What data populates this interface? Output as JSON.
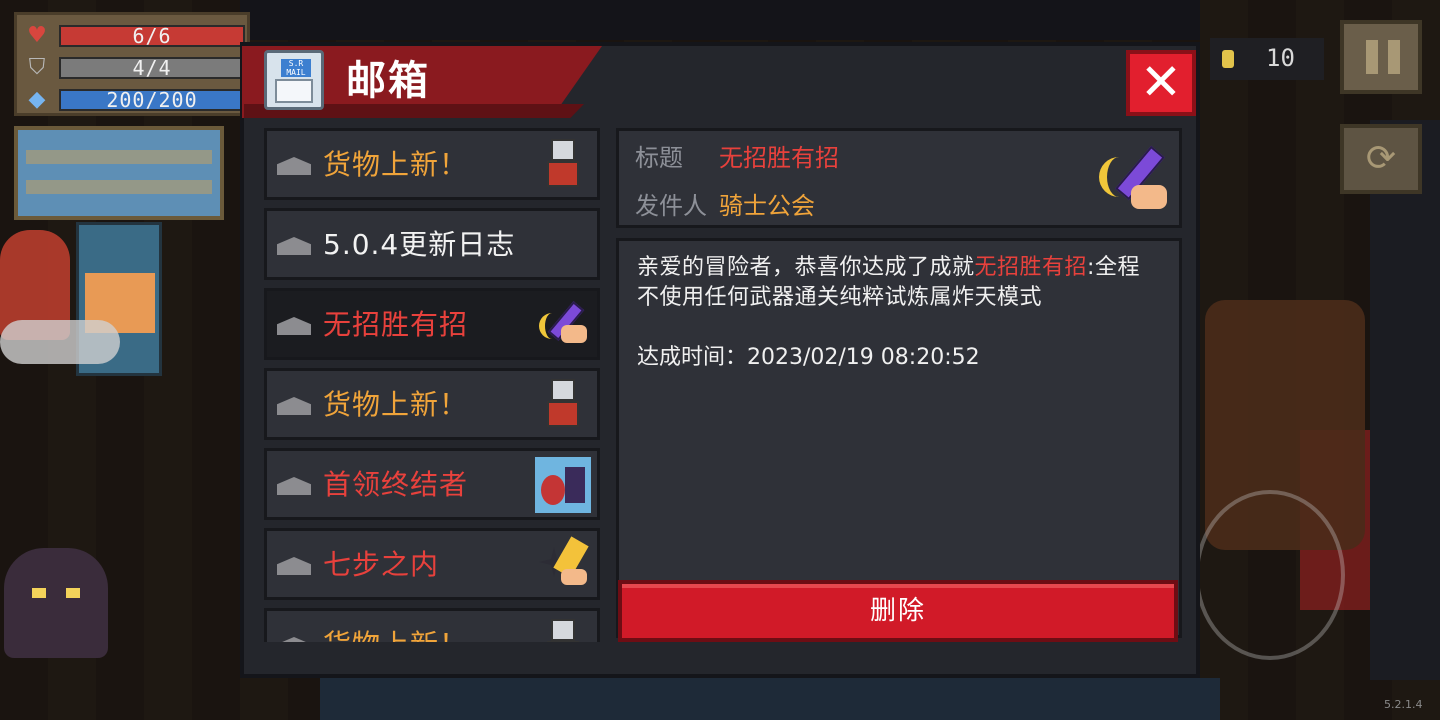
{
  "hud": {
    "hp": "6/6",
    "armor": "4/4",
    "energy": "200/200",
    "hp_icon": "heart-icon",
    "armor_icon": "shield-icon",
    "energy_icon": "gem-icon"
  },
  "coins": {
    "value": "10",
    "icon": "coin-icon"
  },
  "version": "5.2.1.4",
  "mailbox": {
    "title": "邮箱",
    "icon_tag": "S.R MAIL",
    "close_label": "✕",
    "items": [
      {
        "label": "货物上新！",
        "color": "#f0a43a",
        "thumb": "knight-icon"
      },
      {
        "label": "5.0.4更新日志",
        "color": "#f2f2f2",
        "thumb": ""
      },
      {
        "label": "无招胜有招",
        "color": "#e8413c",
        "thumb": "sword-hand-icon",
        "selected": true
      },
      {
        "label": "货物上新！",
        "color": "#f0a43a",
        "thumb": "knight-icon"
      },
      {
        "label": "首领终结者",
        "color": "#e8413c",
        "thumb": "boss-icon"
      },
      {
        "label": "七步之内",
        "color": "#e8413c",
        "thumb": "burst-icon"
      },
      {
        "label": "货物上新！",
        "color": "#f0a43a",
        "thumb": "knight-icon"
      }
    ],
    "detail": {
      "title_key": "标题",
      "title_value": "无招胜有招",
      "sender_key": "发件人",
      "sender_value": "骑士公会",
      "body_prefix": "亲爱的冒险者，恭喜你达成了成就",
      "body_highlight": "无招胜有招",
      "body_suffix": ":全程不使用任何武器通关纯粹试炼属炸天模式",
      "time": "达成时间：2023/02/19 08:20:52",
      "delete_label": "删除"
    }
  }
}
